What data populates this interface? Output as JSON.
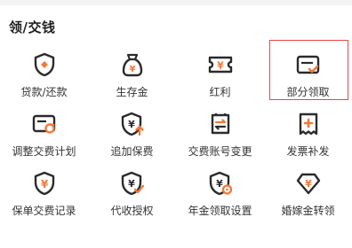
{
  "section": {
    "title": "领/交钱"
  },
  "colors": {
    "icon_dark": "#2b2b2b",
    "accent": "#f07a3a",
    "highlight_border": "#e94545"
  },
  "items": [
    {
      "label": "贷款/还款",
      "icon": "shield-icon"
    },
    {
      "label": "生存金",
      "icon": "money-bag-icon"
    },
    {
      "label": "红利",
      "icon": "ticket-icon"
    },
    {
      "label": "部分领取",
      "icon": "card-check-icon",
      "selected": true
    },
    {
      "label": "调整交费计划",
      "icon": "card-refresh-icon"
    },
    {
      "label": "追加保费",
      "icon": "yen-shield-up-icon"
    },
    {
      "label": "交费账号变更",
      "icon": "transfer-doc-icon"
    },
    {
      "label": "发票补发",
      "icon": "receipt-plus-icon"
    },
    {
      "label": "保单交费记录",
      "icon": "yen-shield-icon"
    },
    {
      "label": "代收授权",
      "icon": "yen-shield-check-icon"
    },
    {
      "label": "年金领取设置",
      "icon": "yen-gear-shield-icon"
    },
    {
      "label": "婚嫁金转领",
      "icon": "diamond-yen-icon"
    }
  ]
}
